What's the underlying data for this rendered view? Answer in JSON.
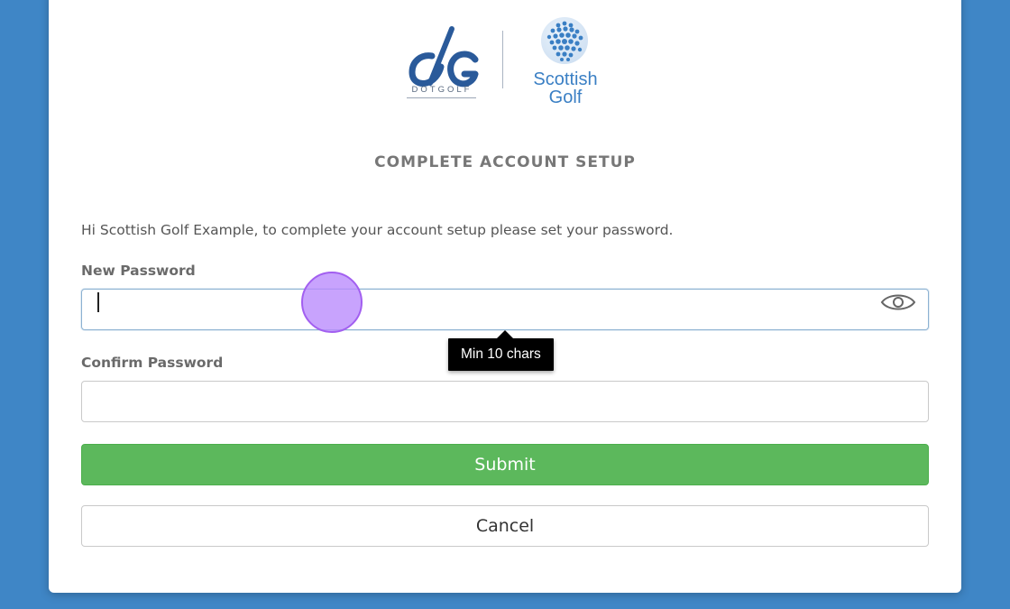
{
  "header": {
    "logo_primary_text": "DOTGOLF",
    "logo_secondary_text_line1": "Scottish",
    "logo_secondary_text_line2": "Golf",
    "title": "COMPLETE ACCOUNT SETUP"
  },
  "form": {
    "intro": "Hi Scottish Golf Example, to complete your account setup please set your password.",
    "new_password_label": "New Password",
    "new_password_value": "",
    "confirm_password_label": "Confirm Password",
    "confirm_password_value": "",
    "tooltip": "Min 10 chars",
    "submit_label": "Submit",
    "cancel_label": "Cancel",
    "reveal_icon": "eye-icon"
  },
  "colors": {
    "background": "#3f86c6",
    "submit": "#5cb85c",
    "brand_blue": "#2f5f9e",
    "scottish_golf_blue": "#3a7fc4"
  }
}
